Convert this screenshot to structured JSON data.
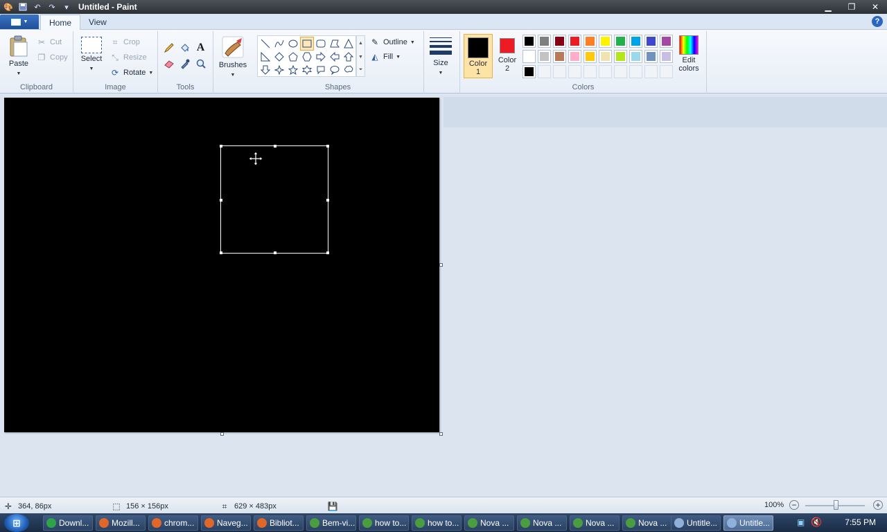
{
  "window": {
    "title": "Untitled - Paint"
  },
  "tabs": {
    "home": "Home",
    "view": "View"
  },
  "ribbon": {
    "clipboard": {
      "paste": "Paste",
      "cut": "Cut",
      "copy": "Copy",
      "label": "Clipboard"
    },
    "image": {
      "select": "Select",
      "crop": "Crop",
      "resize": "Resize",
      "rotate": "Rotate",
      "label": "Image"
    },
    "tools": {
      "label": "Tools"
    },
    "brushes": {
      "label": "Brushes"
    },
    "shapes": {
      "outline": "Outline",
      "fill": "Fill",
      "label": "Shapes"
    },
    "size": {
      "label": "Size"
    },
    "colors": {
      "color1_label_a": "Color",
      "color1_label_b": "1",
      "color2_label_a": "Color",
      "color2_label_b": "2",
      "edit_a": "Edit",
      "edit_b": "colors",
      "label": "Colors",
      "color1": "#000000",
      "color2": "#ed1c24",
      "palette_row1": [
        "#000000",
        "#7f7f7f",
        "#880015",
        "#ed1c24",
        "#ff7f27",
        "#fff200",
        "#22b14c",
        "#00a2e8",
        "#3f48cc",
        "#a349a4"
      ],
      "palette_row2": [
        "#ffffff",
        "#c3c3c3",
        "#b97a57",
        "#ffaec9",
        "#ffc90e",
        "#efe4b0",
        "#b5e61d",
        "#99d9ea",
        "#7092be",
        "#c8bfe7"
      ],
      "palette_row3": [
        "#000000"
      ]
    }
  },
  "status": {
    "cursor_pos": "364, 86px",
    "selection_size": "156 × 156px",
    "canvas_size": "629 × 483px",
    "zoom": "100%"
  },
  "taskbar": {
    "items": [
      {
        "label": "Downl...",
        "color": "#2fa34a"
      },
      {
        "label": "Mozill...",
        "color": "#e0662a"
      },
      {
        "label": "chrom...",
        "color": "#e0662a"
      },
      {
        "label": "Naveg...",
        "color": "#e0662a"
      },
      {
        "label": "Bibliot...",
        "color": "#e0662a"
      },
      {
        "label": "Bem-vi...",
        "color": "#4a9e3f"
      },
      {
        "label": "how to...",
        "color": "#4a9e3f"
      },
      {
        "label": "how to...",
        "color": "#4a9e3f"
      },
      {
        "label": "Nova ...",
        "color": "#4a9e3f"
      },
      {
        "label": "Nova ...",
        "color": "#4a9e3f"
      },
      {
        "label": "Nova ...",
        "color": "#4a9e3f"
      },
      {
        "label": "Nova ...",
        "color": "#4a9e3f"
      },
      {
        "label": "Untitle...",
        "color": "#8fb0d8"
      },
      {
        "label": "Untitle...",
        "color": "#8fb0d8"
      }
    ],
    "clock": "7:55 PM"
  }
}
